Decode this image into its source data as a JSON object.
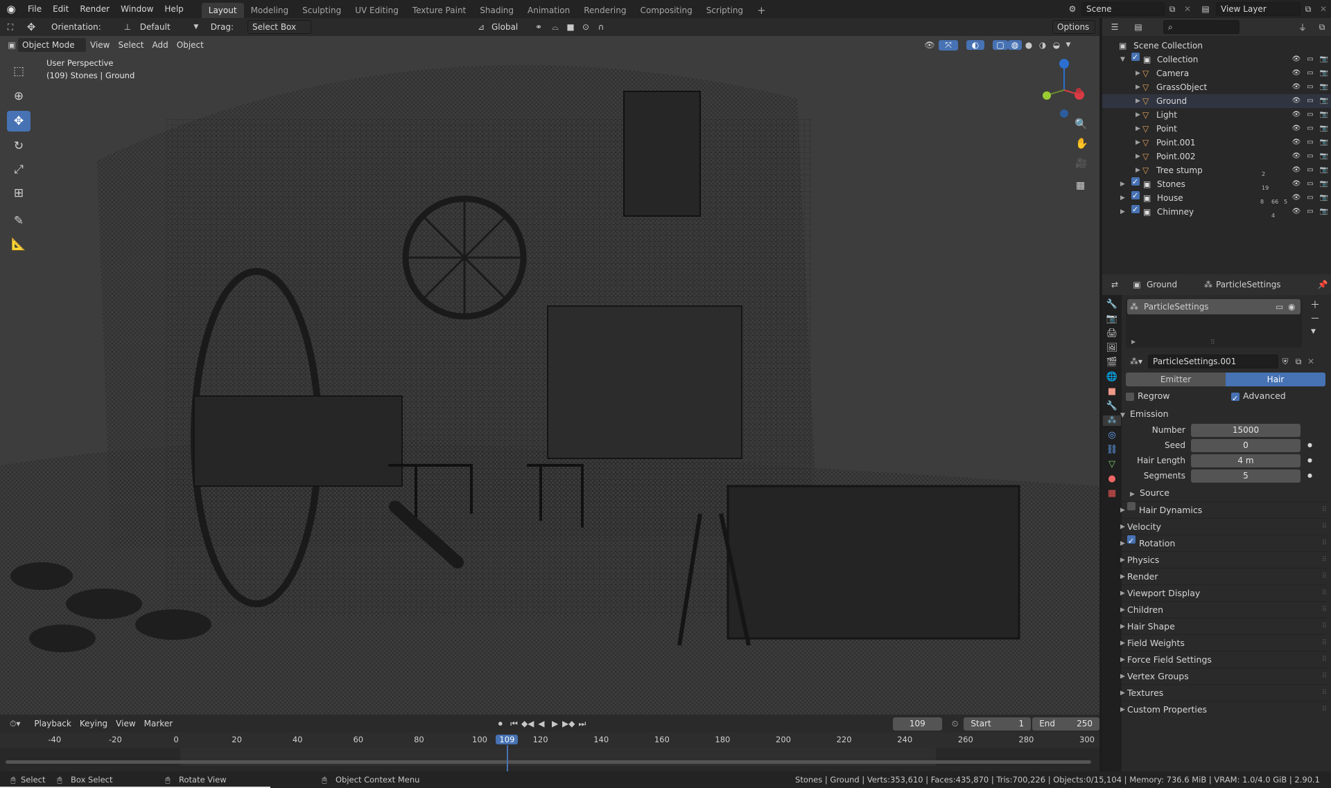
{
  "menu": {
    "items": [
      "File",
      "Edit",
      "Render",
      "Window",
      "Help"
    ]
  },
  "workspaces": [
    "Layout",
    "Modeling",
    "Sculpting",
    "UV Editing",
    "Texture Paint",
    "Shading",
    "Animation",
    "Rendering",
    "Compositing",
    "Scripting"
  ],
  "workspace_add": "+",
  "scene": {
    "name": "Scene"
  },
  "view_layer": {
    "name": "View Layer"
  },
  "tool_header": {
    "orientation_label": "Orientation:",
    "orientation_value": "Default",
    "drag_label": "Drag:",
    "drag_value": "Select Box",
    "transform_orientation": "Global",
    "options": "Options"
  },
  "viewport_header": {
    "mode": "Object Mode",
    "menus": [
      "View",
      "Select",
      "Add",
      "Object"
    ]
  },
  "viewport": {
    "perspective": "User Perspective",
    "info": "(109) Stones | Ground"
  },
  "outliner": {
    "root": "Scene Collection",
    "rows": [
      {
        "name": "Collection",
        "indent": 0,
        "type": "collection"
      },
      {
        "name": "Camera",
        "indent": 1,
        "type": "object"
      },
      {
        "name": "GrassObject",
        "indent": 1,
        "type": "object"
      },
      {
        "name": "Ground",
        "indent": 1,
        "type": "object"
      },
      {
        "name": "Light",
        "indent": 1,
        "type": "object"
      },
      {
        "name": "Point",
        "indent": 1,
        "type": "object"
      },
      {
        "name": "Point.001",
        "indent": 1,
        "type": "object"
      },
      {
        "name": "Point.002",
        "indent": 1,
        "type": "object"
      },
      {
        "name": "Tree stump",
        "indent": 1,
        "type": "object"
      },
      {
        "name": "Stones",
        "indent": 0,
        "type": "collection"
      },
      {
        "name": "House",
        "indent": 0,
        "type": "collection"
      },
      {
        "name": "Chimney",
        "indent": 0,
        "type": "collection"
      }
    ],
    "badges": {
      "stones": "19",
      "house_a": "8",
      "house_b": "66",
      "house_c": "5",
      "chimney": "4",
      "tree_stump": "2"
    }
  },
  "properties": {
    "breadcrumb_object": "Ground",
    "breadcrumb_data": "ParticleSettings",
    "slot_name": "ParticleSettings",
    "settings_name": "ParticleSettings.001",
    "type_tabs": [
      "Emitter",
      "Hair"
    ],
    "regrow": "Regrow",
    "advanced": "Advanced",
    "emission": {
      "title": "Emission",
      "fields": [
        {
          "label": "Number",
          "value": "15000"
        },
        {
          "label": "Seed",
          "value": "0"
        },
        {
          "label": "Hair Length",
          "value": "4 m"
        },
        {
          "label": "Segments",
          "value": "5"
        }
      ],
      "source": "Source"
    },
    "panels": [
      {
        "label": "Hair Dynamics",
        "checkbox": "off"
      },
      {
        "label": "Velocity"
      },
      {
        "label": "Rotation",
        "checkbox": "on"
      },
      {
        "label": "Physics"
      },
      {
        "label": "Render"
      },
      {
        "label": "Viewport Display"
      },
      {
        "label": "Children"
      },
      {
        "label": "Hair Shape"
      },
      {
        "label": "Field Weights"
      },
      {
        "label": "Force Field Settings"
      },
      {
        "label": "Vertex Groups"
      },
      {
        "label": "Textures"
      },
      {
        "label": "Custom Properties"
      }
    ]
  },
  "timeline": {
    "menus": [
      "Playback",
      "Keying",
      "View",
      "Marker"
    ],
    "current_frame": "109",
    "start_label": "Start",
    "start_value": "1",
    "end_label": "End",
    "end_value": "250",
    "ruler": [
      "-40",
      "-20",
      "0",
      "20",
      "40",
      "60",
      "80",
      "100",
      "109",
      "120",
      "140",
      "160",
      "180",
      "200",
      "220",
      "240",
      "260",
      "280",
      "300"
    ]
  },
  "status": {
    "hints": [
      "Select",
      "Box Select",
      "Rotate View",
      "Object Context Menu"
    ],
    "stats": "Stones | Ground | Verts:353,610 | Faces:435,870 | Tris:700,226 | Objects:0/15,104 | Memory: 736.6 MiB | VRAM: 1.0/4.0 GiB | 2.90.1"
  },
  "colors": {
    "accent": "#4772b3",
    "background": "#1d1d1d",
    "viewport": "#3b3b3b",
    "panel": "#303030"
  }
}
